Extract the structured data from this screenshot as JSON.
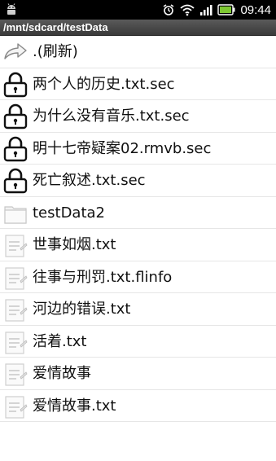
{
  "status_bar": {
    "time": "09:44",
    "icons": [
      "android-icon",
      "alarm-icon",
      "wifi-icon",
      "signal-icon",
      "battery-icon"
    ],
    "background": "#000000"
  },
  "path_bar": {
    "path": "/mnt/sdcard/testData",
    "background": "#4a4a4a"
  },
  "files": [
    {
      "label": ".(刷新)",
      "icon": "refresh-arrow-icon"
    },
    {
      "label": "两个人的历史.txt.sec",
      "icon": "lock-icon"
    },
    {
      "label": "为什么没有音乐.txt.sec",
      "icon": "lock-icon"
    },
    {
      "label": "明十七帝疑案02.rmvb.sec",
      "icon": "lock-icon"
    },
    {
      "label": "死亡叙述.txt.sec",
      "icon": "lock-icon"
    },
    {
      "label": "testData2",
      "icon": "folder-icon"
    },
    {
      "label": "世事如烟.txt",
      "icon": "text-file-icon"
    },
    {
      "label": "往事与刑罚.txt.flinfo",
      "icon": "text-file-icon"
    },
    {
      "label": "河边的错误.txt",
      "icon": "text-file-icon"
    },
    {
      "label": "活着.txt",
      "icon": "text-file-icon"
    },
    {
      "label": "爱情故事",
      "icon": "text-file-icon"
    },
    {
      "label": "爱情故事.txt",
      "icon": "text-file-icon"
    }
  ]
}
